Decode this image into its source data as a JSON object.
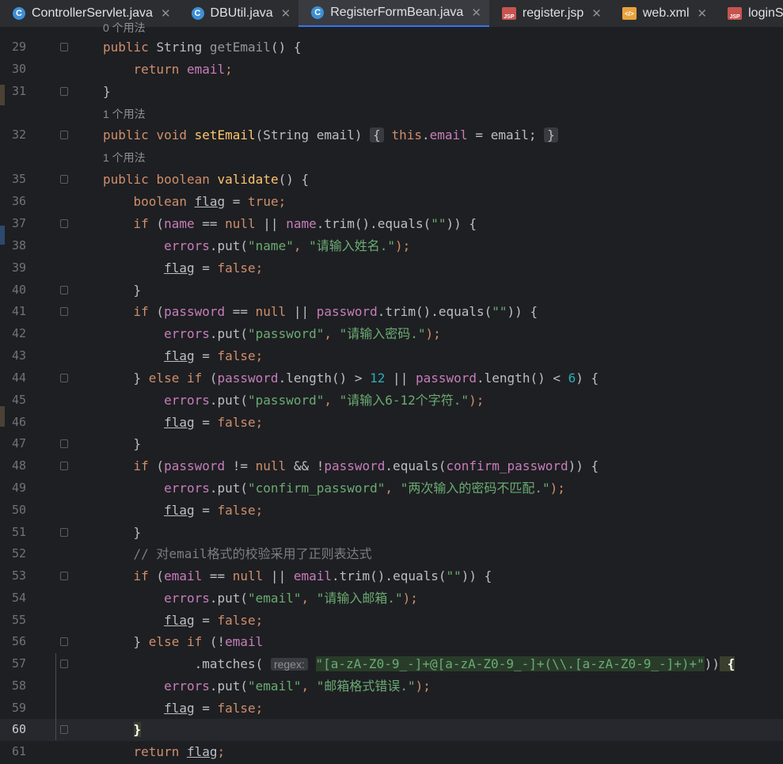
{
  "tabs": [
    {
      "label": "ControllerServlet.java",
      "icon": "java-class-icon",
      "active": false
    },
    {
      "label": "DBUtil.java",
      "icon": "java-class-icon",
      "active": false
    },
    {
      "label": "RegisterFormBean.java",
      "icon": "java-class-icon",
      "active": true
    },
    {
      "label": "register.jsp",
      "icon": "jsp-file-icon",
      "active": false
    },
    {
      "label": "web.xml",
      "icon": "xml-file-icon",
      "active": false
    },
    {
      "label": "loginSuccess.",
      "icon": "jsp-file-icon",
      "active": false
    }
  ],
  "usage_hint": "1 个用法",
  "top_hint_partial": "0 个用法",
  "regex_param_hint": "regex:",
  "line_numbers": [
    "29",
    "30",
    "31",
    "32",
    "35",
    "36",
    "37",
    "38",
    "39",
    "40",
    "41",
    "42",
    "43",
    "44",
    "45",
    "46",
    "47",
    "48",
    "49",
    "50",
    "51",
    "52",
    "53",
    "54",
    "55",
    "56",
    "57",
    "58",
    "59",
    "60",
    "61"
  ],
  "code": {
    "l29": [
      "public",
      "String",
      "getEmail",
      "() {"
    ],
    "l30": [
      "return",
      "email",
      ";"
    ],
    "l31": "}",
    "l32": [
      "public",
      "void",
      "setEmail",
      "(String email)",
      "{",
      "this",
      "email",
      " = email;",
      "}"
    ],
    "l35": [
      "public",
      "boolean",
      "validate",
      "() {"
    ],
    "l36": [
      "boolean",
      "flag",
      " = ",
      "true",
      ";"
    ],
    "l37": [
      "if",
      " (",
      "name",
      " == ",
      "null",
      " || ",
      "name",
      ".trim().equals(",
      "\"\"",
      ")) {"
    ],
    "l38": [
      "errors",
      ".put(",
      "\"name\"",
      ", ",
      "\"请输入姓名.\"",
      ");"
    ],
    "l39": [
      "flag",
      " = ",
      "false",
      ";"
    ],
    "l40": "}",
    "l41": [
      "if",
      " (",
      "password",
      " == ",
      "null",
      " || ",
      "password",
      ".trim().equals(",
      "\"\"",
      ")) {"
    ],
    "l42": [
      "errors",
      ".put(",
      "\"password\"",
      ", ",
      "\"请输入密码.\"",
      ");"
    ],
    "l43": [
      "flag",
      " = ",
      "false",
      ";"
    ],
    "l44": [
      "} ",
      "else if",
      " (",
      "password",
      ".length() > ",
      "12",
      " || ",
      "password",
      ".length() < ",
      "6",
      ") {"
    ],
    "l45": [
      "errors",
      ".put(",
      "\"password\"",
      ", ",
      "\"请输入6-12个字符.\"",
      ");"
    ],
    "l46": [
      "flag",
      " = ",
      "false",
      ";"
    ],
    "l47": "}",
    "l48": [
      "if",
      " (",
      "password",
      " != ",
      "null",
      " && !",
      "password",
      ".equals(",
      "confirm_password",
      ")) {"
    ],
    "l49": [
      "errors",
      ".put(",
      "\"confirm_password\"",
      ", ",
      "\"两次输入的密码不匹配.\"",
      ");"
    ],
    "l50": [
      "flag",
      " = ",
      "false",
      ";"
    ],
    "l51": "}",
    "l52": "// 对email格式的校验采用了正则表达式",
    "l53": [
      "if",
      " (",
      "email",
      " == ",
      "null",
      " || ",
      "email",
      ".trim().equals(",
      "\"\"",
      ")) {"
    ],
    "l54": [
      "errors",
      ".put(",
      "\"email\"",
      ", ",
      "\"请输入邮箱.\"",
      ");"
    ],
    "l55": [
      "flag",
      " = ",
      "false",
      ";"
    ],
    "l56": [
      "} ",
      "else if",
      " (!",
      "email"
    ],
    "l57": [
      ".matches(",
      "\"[a-zA-Z0-9_-]+@[a-zA-Z0-9_-]+(\\\\.[a-zA-Z0-9_-]+)+\"",
      "))",
      " {"
    ],
    "l58": [
      "errors",
      ".put(",
      "\"email\"",
      ", ",
      "\"邮箱格式错误.\"",
      ");"
    ],
    "l59": [
      "flag",
      " = ",
      "false",
      ";"
    ],
    "l60": "}",
    "l61": [
      "return",
      "flag",
      ";"
    ]
  },
  "colors": {
    "keyword": "#cf8e6d",
    "string": "#6aab73",
    "field": "#c77dbb",
    "method": "#56a8f5",
    "number": "#2aacb8",
    "comment": "#7a7e85",
    "background": "#1e1f22"
  }
}
